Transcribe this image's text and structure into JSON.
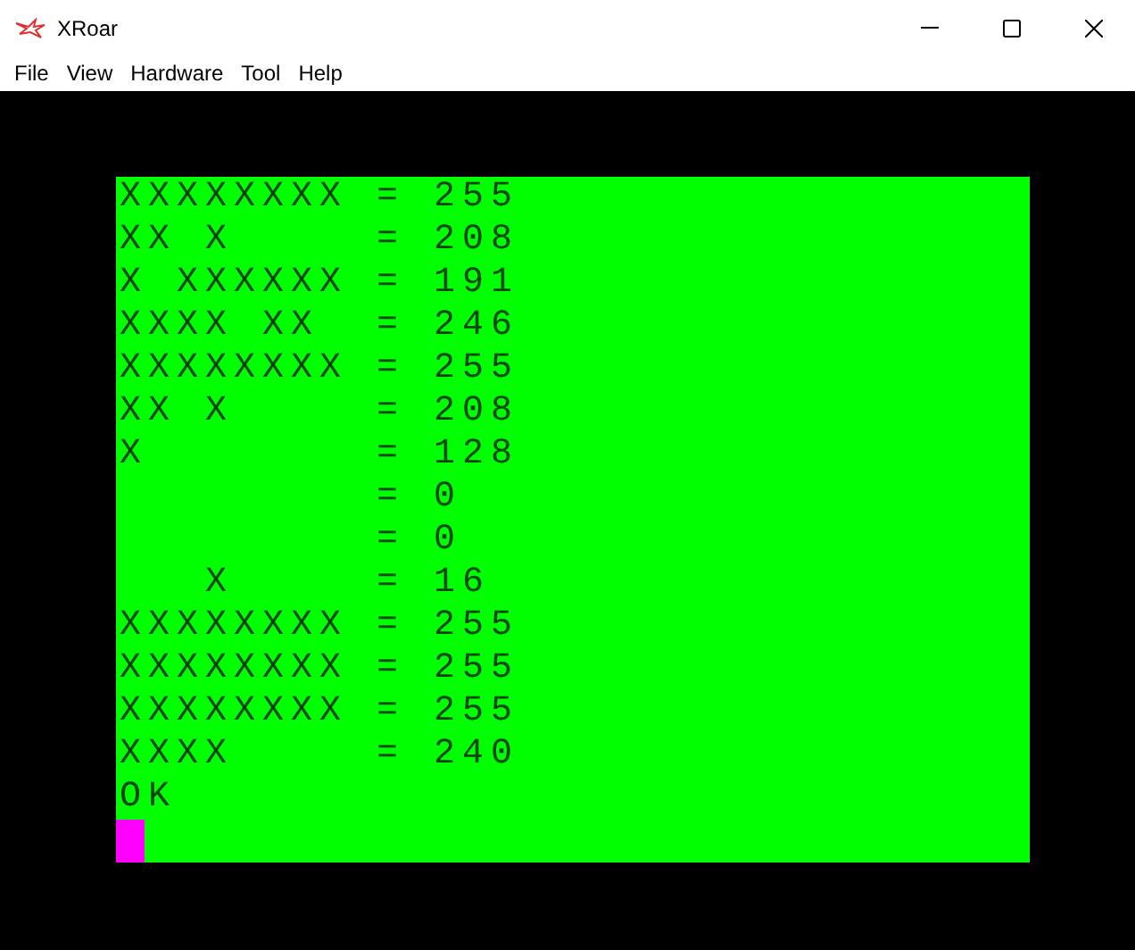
{
  "window": {
    "title": "XRoar"
  },
  "menu_bar": [
    "File",
    "View",
    "Hardware",
    "Tool",
    "Help"
  ],
  "screen": {
    "lines": [
      "XXXXXXXX = 255",
      "XX X     = 208",
      "X XXXXXX = 191",
      "XXXX XX  = 246",
      "XXXXXXXX = 255",
      "XX X     = 208",
      "X        = 128",
      "         = 0",
      "         = 0",
      "   X     = 16",
      "XXXXXXXX = 255",
      "XXXXXXXX = 255",
      "XXXXXXXX = 255",
      "XXXX     = 240",
      "OK"
    ],
    "cursor": {
      "visible": true
    }
  }
}
